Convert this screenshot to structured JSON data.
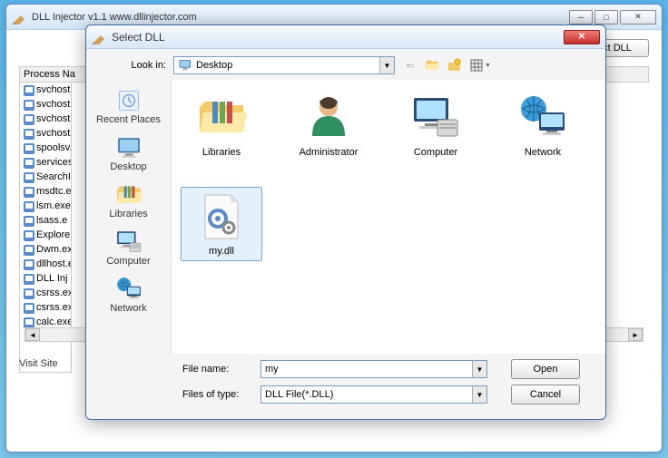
{
  "main_window": {
    "title": "DLL Injector v1.1  www.dllinjector.com",
    "select_dll_btn": "ct DLL",
    "visit_site_label": "Visit Site",
    "process_header": "Process Na",
    "processes": [
      "svchost",
      "svchost",
      "svchost",
      "svchost",
      "spoolsv.",
      "services",
      "SearchI",
      "msdtc.e",
      "lsm.exe",
      "lsass.e",
      "Explore",
      "Dwm.ex",
      "dllhost.e",
      "DLL Inj",
      "csrss.ex",
      "csrss.ex",
      "calc.exe"
    ]
  },
  "dialog": {
    "title": "Select DLL",
    "lookin_label": "Look in:",
    "lookin_value": "Desktop",
    "places": [
      {
        "name": "Recent Places"
      },
      {
        "name": "Desktop"
      },
      {
        "name": "Libraries"
      },
      {
        "name": "Computer"
      },
      {
        "name": "Network"
      }
    ],
    "items": [
      {
        "name": "Libraries",
        "kind": "libraries"
      },
      {
        "name": "Administrator",
        "kind": "user"
      },
      {
        "name": "Computer",
        "kind": "computer"
      },
      {
        "name": "Network",
        "kind": "network"
      },
      {
        "name": "my.dll",
        "kind": "dll",
        "selected": true
      }
    ],
    "filename_label": "File name:",
    "filename_value": "my",
    "filetype_label": "Files of type:",
    "filetype_value": "DLL File(*.DLL)",
    "open_btn": "Open",
    "cancel_btn": "Cancel"
  }
}
